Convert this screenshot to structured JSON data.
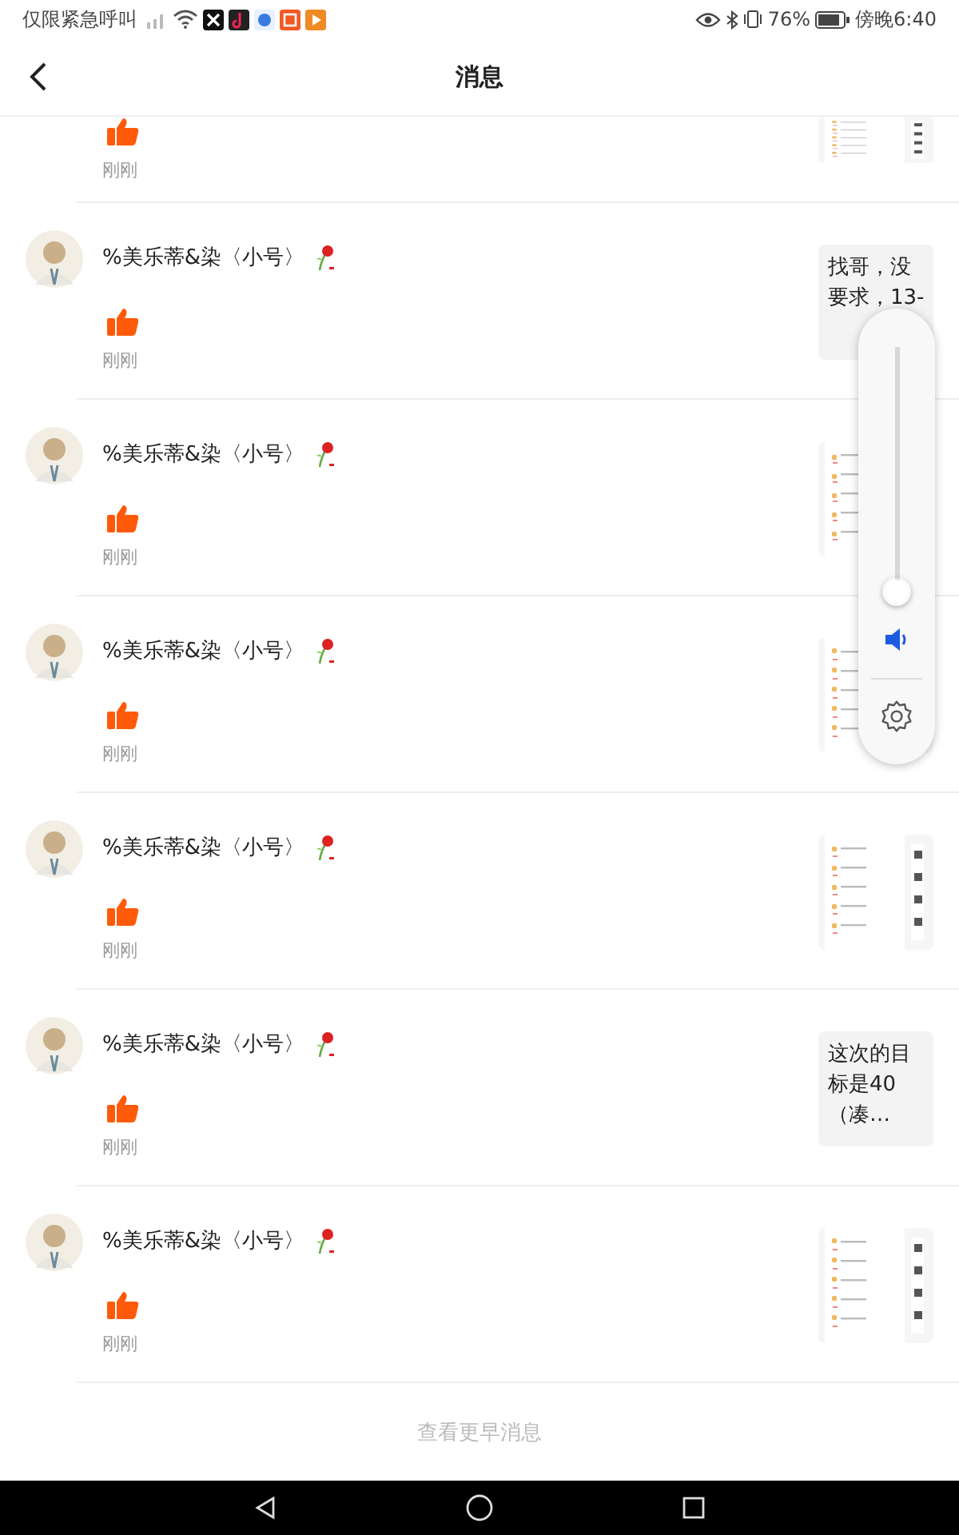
{
  "status_bar": {
    "carrier": "仅限紧急呼叫",
    "battery": "76%",
    "time": "傍晚6:40"
  },
  "header": {
    "title": "消息"
  },
  "messages": [
    {
      "time": "刚刚"
    },
    {
      "name": "%美乐蒂&染〈小号〉",
      "time": "刚刚",
      "preview": {
        "kind": "text",
        "text": "找哥，没要求，13-"
      }
    },
    {
      "name": "%美乐蒂&染〈小号〉",
      "time": "刚刚"
    },
    {
      "name": "%美乐蒂&染〈小号〉",
      "time": "刚刚"
    },
    {
      "name": "%美乐蒂&染〈小号〉",
      "time": "刚刚"
    },
    {
      "name": "%美乐蒂&染〈小号〉",
      "time": "刚刚",
      "preview": {
        "kind": "text",
        "text": "这次的目标是40（凑…"
      }
    },
    {
      "name": "%美乐蒂&染〈小号〉",
      "time": "刚刚"
    }
  ],
  "more": "查看更早消息",
  "volume": {
    "level": 0.06
  }
}
